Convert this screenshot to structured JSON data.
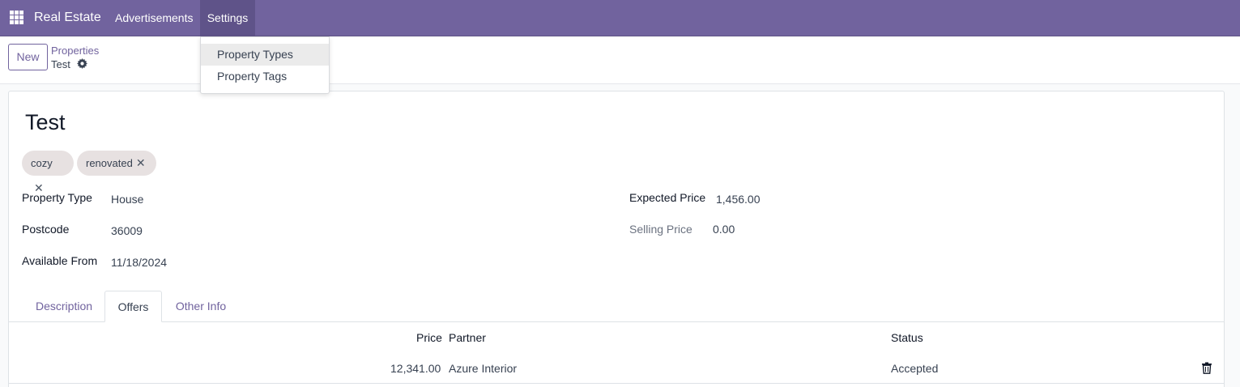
{
  "navbar": {
    "app_name": "Real Estate",
    "menu_advertisements": "Advertisements",
    "menu_settings": "Settings",
    "accent_color": "#71639e"
  },
  "settings_menu": {
    "items": [
      "Property Types",
      "Property Tags"
    ]
  },
  "control_panel": {
    "new_label": "New",
    "breadcrumb_parent": "Properties",
    "breadcrumb_current": "Test"
  },
  "record": {
    "title": "Test",
    "tags": [
      "cozy",
      "renovated"
    ],
    "fields_left": [
      {
        "label": "Property Type",
        "value": "House"
      },
      {
        "label": "Postcode",
        "value": "36009"
      },
      {
        "label": "Available From",
        "value": "11/18/2024"
      }
    ],
    "fields_right": [
      {
        "label": "Expected Price",
        "value": "1,456.00"
      },
      {
        "label": "Selling Price",
        "value": "0.00"
      }
    ]
  },
  "tabs": [
    "Description",
    "Offers",
    "Other Info"
  ],
  "active_tab": "Offers",
  "offers_table": {
    "columns": [
      "Price",
      "Partner",
      "Status"
    ],
    "rows": [
      {
        "price": "12,341.00",
        "partner": "Azure Interior",
        "status": "Accepted"
      }
    ]
  }
}
